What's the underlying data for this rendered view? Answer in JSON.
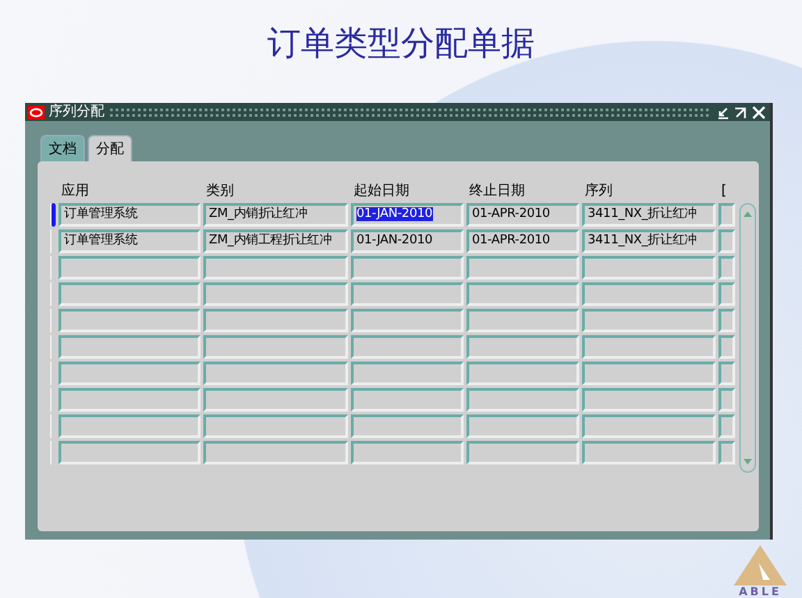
{
  "slide_title": "订单类型分配单据",
  "window": {
    "title": "序列分配"
  },
  "tabs": [
    {
      "label": "文档",
      "selected": false
    },
    {
      "label": "分配",
      "selected": true
    }
  ],
  "table": {
    "columns": [
      "应用",
      "类别",
      "起始日期",
      "终止日期",
      "序列",
      "["
    ],
    "rows": [
      {
        "selected": true,
        "cells": [
          {
            "text": "订单管理系统",
            "selected": false
          },
          {
            "text": "ZM_内销折让红冲",
            "selected": false
          },
          {
            "text": "01-JAN-2010",
            "selected": true
          },
          {
            "text": "01-APR-2010",
            "selected": false
          },
          {
            "text": "3411_NX_折让红冲",
            "selected": false
          }
        ]
      },
      {
        "selected": false,
        "cells": [
          {
            "text": "订单管理系统",
            "selected": false
          },
          {
            "text": "ZM_内销工程折让红冲",
            "selected": false
          },
          {
            "text": "01-JAN-2010",
            "selected": false
          },
          {
            "text": "01-APR-2010",
            "selected": false
          },
          {
            "text": "3411_NX_折让红冲",
            "selected": false
          }
        ]
      }
    ]
  },
  "logo_text": "ABLE"
}
